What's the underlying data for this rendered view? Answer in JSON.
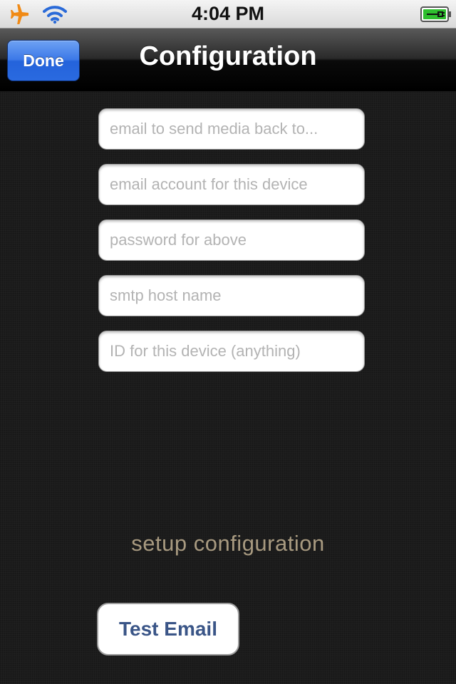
{
  "status_bar": {
    "time": "4:04 PM",
    "icons": [
      "airplane-icon",
      "wifi-icon",
      "battery-charging-icon"
    ],
    "airplane_color": "#f08a16",
    "battery_color": "#2fbf2f"
  },
  "nav": {
    "done_label": "Done",
    "title": "Configuration",
    "done_color": "#2f6fe3"
  },
  "form": {
    "fields": [
      {
        "placeholder": "email to send media back to...",
        "value": ""
      },
      {
        "placeholder": "email account for this device",
        "value": ""
      },
      {
        "placeholder": "password for above",
        "value": ""
      },
      {
        "placeholder": "smtp host name",
        "value": ""
      },
      {
        "placeholder": "ID for this device (anything)",
        "value": ""
      }
    ]
  },
  "status_message": "setup configuration",
  "test_button_label": "Test Email",
  "colors": {
    "background": "#1c1c1c",
    "status_message": "#a89a80",
    "test_button_text": "#3a5587"
  }
}
